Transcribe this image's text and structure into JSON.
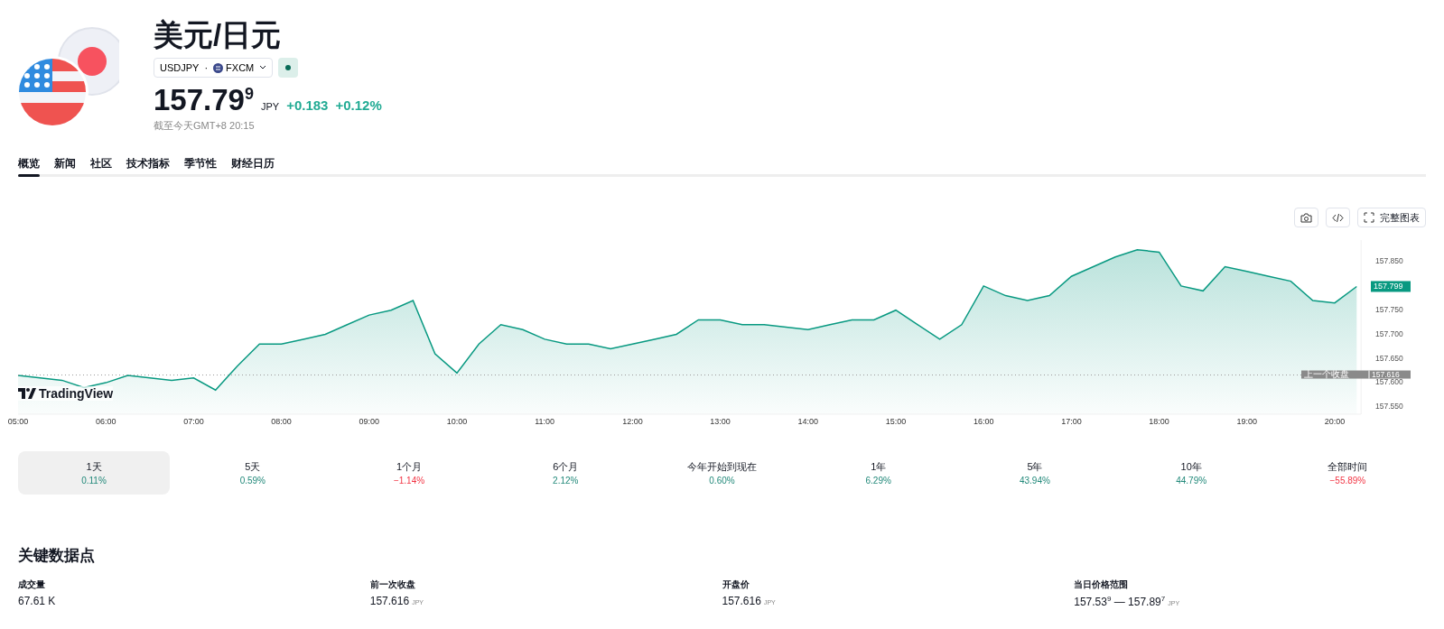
{
  "header": {
    "title": "美元/日元",
    "symbol": "USDJPY",
    "separator": "·",
    "exchange": "FXCM",
    "market_open": true,
    "price": "157.79$^{9}$",
    "currency": "JPY",
    "change": "+0.183",
    "change_percent": "+0.12%",
    "timestamp": "截至今天GMT+8 20:15"
  },
  "tabs": [
    {
      "label": "概览",
      "selected": true
    },
    {
      "label": "新闻",
      "selected": false
    },
    {
      "label": "社区",
      "selected": false
    },
    {
      "label": "技术指标",
      "selected": false
    },
    {
      "label": "季节性",
      "selected": false
    },
    {
      "label": "财经日历",
      "selected": false
    }
  ],
  "chart_toolbar": {
    "fullscreen_label": "完整图表"
  },
  "chart": {
    "logo": "TradingView",
    "chart_data": {
      "type": "area",
      "x": [
        5,
        5.25,
        5.5,
        5.75,
        6,
        6.25,
        6.5,
        6.75,
        7,
        7.25,
        7.5,
        7.75,
        8,
        8.25,
        8.5,
        8.75,
        9,
        9.25,
        9.5,
        9.75,
        10,
        10.25,
        10.5,
        10.75,
        11,
        11.25,
        11.5,
        11.75,
        12,
        12.25,
        12.5,
        12.75,
        13,
        13.25,
        13.5,
        13.75,
        14,
        14.25,
        14.5,
        14.75,
        15,
        15.25,
        15.5,
        15.75,
        16,
        16.25,
        16.5,
        16.75,
        17,
        17.25,
        17.5,
        17.75,
        18,
        18.25,
        18.5,
        18.75,
        19,
        19.25,
        19.5,
        19.75,
        20,
        20.25
      ],
      "series": [
        {
          "color": "#089981",
          "values": [
            157.615,
            157.61,
            157.605,
            157.59,
            157.6,
            157.615,
            157.61,
            157.605,
            157.61,
            157.585,
            157.635,
            157.68,
            157.68,
            157.69,
            157.7,
            157.72,
            157.74,
            157.75,
            157.77,
            157.66,
            157.62,
            157.68,
            157.72,
            157.71,
            157.69,
            157.68,
            157.68,
            157.67,
            157.68,
            157.69,
            157.7,
            157.73,
            157.73,
            157.72,
            157.72,
            157.715,
            157.71,
            157.72,
            157.73,
            157.73,
            157.75,
            157.72,
            157.69,
            157.72,
            157.8,
            157.78,
            157.77,
            157.78,
            157.82,
            157.84,
            157.86,
            157.875,
            157.87,
            157.8,
            157.79,
            157.84,
            157.83,
            157.82,
            157.81,
            157.77,
            157.765,
            157.799
          ]
        }
      ],
      "xticks": [
        {
          "value": 5,
          "label": "05:00"
        },
        {
          "value": 6,
          "label": "06:00"
        },
        {
          "value": 7,
          "label": "07:00"
        },
        {
          "value": 8,
          "label": "08:00"
        },
        {
          "value": 9,
          "label": "09:00"
        },
        {
          "value": 10,
          "label": "10:00"
        },
        {
          "value": 11,
          "label": "11:00"
        },
        {
          "value": 12,
          "label": "12:00"
        },
        {
          "value": 13,
          "label": "13:00"
        },
        {
          "value": 14,
          "label": "14:00"
        },
        {
          "value": 15,
          "label": "15:00"
        },
        {
          "value": 16,
          "label": "16:00"
        },
        {
          "value": 17,
          "label": "17:00"
        },
        {
          "value": 18,
          "label": "18:00"
        },
        {
          "value": 19,
          "label": "19:00"
        },
        {
          "value": 20,
          "label": "20:00"
        }
      ],
      "yticks": [
        {
          "value": 157.85,
          "label": "157.850"
        },
        {
          "value": 157.75,
          "label": "157.750"
        },
        {
          "value": 157.7,
          "label": "157.700"
        },
        {
          "value": 157.65,
          "label": "157.650"
        },
        {
          "value": 157.6,
          "label": "157.600"
        },
        {
          "value": 157.55,
          "label": "157.550"
        }
      ],
      "xlim": [
        5,
        20.3
      ],
      "ylim": [
        157.535,
        157.895
      ],
      "ref_lines": [
        {
          "axis": "y",
          "value": 157.616,
          "label": "157.616"
        }
      ],
      "annotations": [
        "157.799",
        "上一个收盘"
      ]
    }
  },
  "periods": [
    {
      "label": "1天",
      "change": "0.11%",
      "kind": "gain",
      "selected": true
    },
    {
      "label": "5天",
      "change": "0.59%",
      "kind": "gain",
      "selected": false
    },
    {
      "label": "1个月",
      "change": "−1.14%",
      "kind": "loss",
      "selected": false
    },
    {
      "label": "6个月",
      "change": "2.12%",
      "kind": "gain",
      "selected": false
    },
    {
      "label": "今年开始到现在",
      "change": "0.60%",
      "kind": "gain",
      "selected": false
    },
    {
      "label": "1年",
      "change": "6.29%",
      "kind": "gain",
      "selected": false
    },
    {
      "label": "5年",
      "change": "43.94%",
      "kind": "gain",
      "selected": false
    },
    {
      "label": "10年",
      "change": "44.79%",
      "kind": "gain",
      "selected": false
    },
    {
      "label": "全部时间",
      "change": "−55.89%",
      "kind": "loss",
      "selected": false
    }
  ],
  "key_data": {
    "title": "关键数据点",
    "items": [
      {
        "label": "成交量",
        "value": "67.61 K"
      },
      {
        "label": "前一次收盘",
        "value": "157.616",
        "unit": "JPY"
      },
      {
        "label": "开盘价",
        "value": "157.616",
        "unit": "JPY"
      },
      {
        "label": "当日价格范围",
        "value": "157.53$^{9}$ — 157.89$^{7}$",
        "unit": "JPY"
      }
    ]
  }
}
